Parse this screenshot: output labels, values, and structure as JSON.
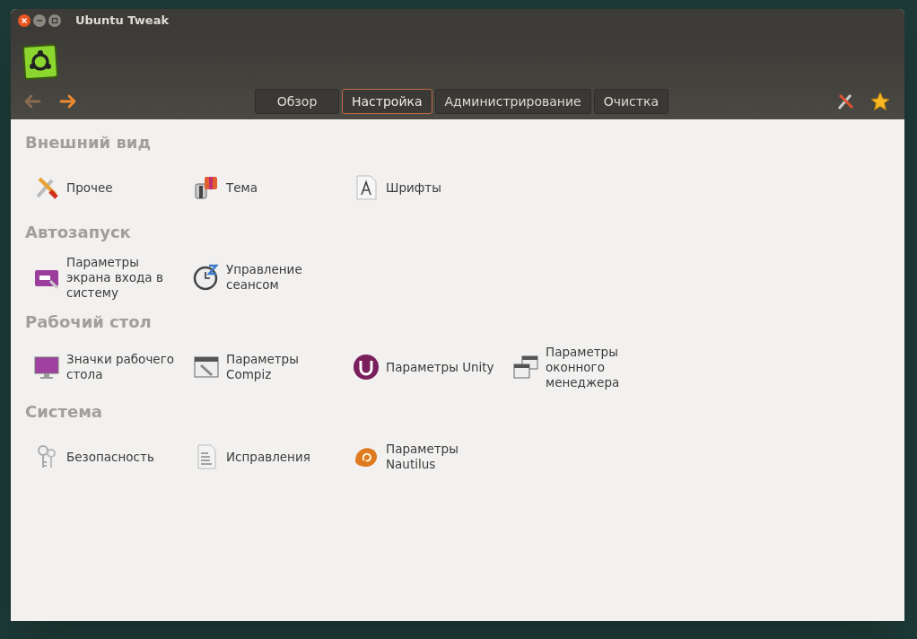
{
  "window": {
    "title": "Ubuntu Tweak"
  },
  "navigation": [
    {
      "kind": "back",
      "disabled": true
    },
    {
      "kind": "forward",
      "disabled": false
    }
  ],
  "tabs": [
    {
      "label": "Обзор",
      "selected": false
    },
    {
      "label": "Настройка",
      "selected": true
    },
    {
      "label": "Администрирование",
      "selected": false
    },
    {
      "label": "Очистка",
      "selected": false
    }
  ],
  "sections": [
    {
      "title": "Внешний вид",
      "items": [
        {
          "label": "Прочее",
          "kind": "tools"
        },
        {
          "label": "Тема",
          "kind": "theme"
        },
        {
          "label": "Шрифты",
          "kind": "font"
        }
      ]
    },
    {
      "title": "Автозапуск",
      "items": [
        {
          "label": "Параметры экрана входа в систему",
          "kind": "login"
        },
        {
          "label": "Управление сеансом",
          "kind": "session"
        }
      ]
    },
    {
      "title": "Рабочий стол",
      "items": [
        {
          "label": "Значки рабочего стола",
          "kind": "desktop"
        },
        {
          "label": "Параметры Compiz",
          "kind": "compiz"
        },
        {
          "label": "Параметры Unity",
          "kind": "unity"
        },
        {
          "label": "Параметры оконного менеджера",
          "kind": "windows"
        }
      ]
    },
    {
      "title": "Система",
      "items": [
        {
          "label": "Безопасность",
          "kind": "security"
        },
        {
          "label": "Исправления",
          "kind": "patches"
        },
        {
          "label": "Параметры Nautilus",
          "kind": "nautilus"
        }
      ]
    }
  ]
}
